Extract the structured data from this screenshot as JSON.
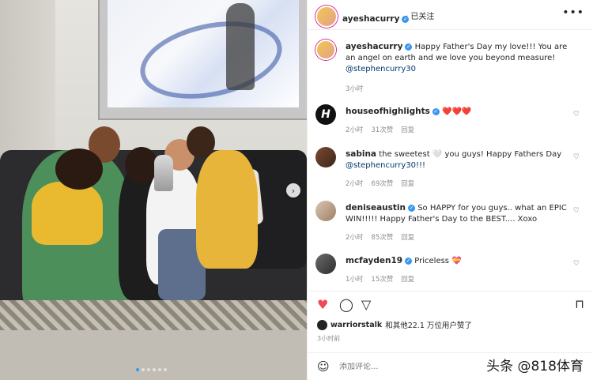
{
  "header": {
    "username": "ayeshacurry",
    "follow_status": "已关注",
    "more": "•••"
  },
  "caption": {
    "username": "ayeshacurry",
    "text": "Happy Father's Day my love!!! You are an angel on earth and we love you beyond measure!",
    "mention": "@stephencurry30",
    "time": "3小时"
  },
  "comments": [
    {
      "username": "houseofhighlights",
      "avatar_letter": "H",
      "text": "❤️❤️❤️",
      "time": "2小时",
      "likes": "31次赞",
      "reply": "回复"
    },
    {
      "username": "sabina",
      "text": "the sweetest 🤍 you guys! Happy Fathers Day",
      "mention": "@stephencurry30!!!",
      "time": "2小时",
      "likes": "69次赞",
      "reply": "回复"
    },
    {
      "username": "deniseaustin",
      "text": "So HAPPY for you guys.. what an EPIC WIN!!!!! Happy Father's Day to the BEST.... Xoxo",
      "time": "2小时",
      "likes": "85次赞",
      "reply": "回复"
    },
    {
      "username": "mcfayden19",
      "text": "Priceless 💝",
      "time": "1小时",
      "likes": "15次赞",
      "reply": "回复"
    }
  ],
  "likes_line": {
    "user": "warriorstalk",
    "text": "和其他22.1 万位用户赞了"
  },
  "post_time": "3小时前",
  "add_comment": {
    "placeholder": "添加评论..."
  },
  "watermark": "头条 @818体育",
  "icons": {
    "like": "heart-icon",
    "comment": "comment-icon",
    "share": "share-icon",
    "save": "bookmark-icon",
    "emoji": "emoji-icon"
  },
  "colors": {
    "like_red": "#ed4956",
    "verified_blue": "#3897f0",
    "mention": "#00376b"
  }
}
